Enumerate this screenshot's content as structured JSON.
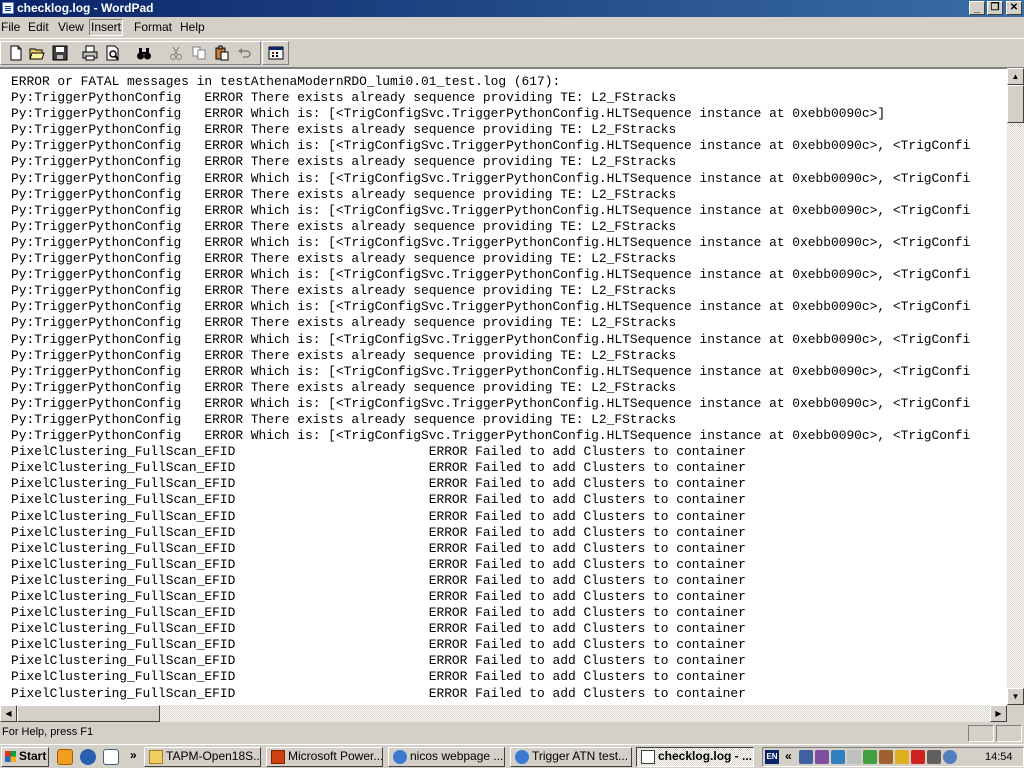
{
  "window": {
    "title": "checklog.log - WordPad",
    "buttons": {
      "minimize": "_",
      "maximize": "❐",
      "close": "✕"
    }
  },
  "menu": [
    "File",
    "Edit",
    "View",
    "Insert",
    "Format",
    "Help"
  ],
  "toolbar": {
    "icons": [
      "new-document-icon",
      "open-folder-icon",
      "save-disk-icon",
      "print-icon",
      "print-preview-icon",
      "find-binoculars-icon",
      "cut-scissors-icon",
      "copy-icon",
      "paste-icon",
      "undo-icon",
      "insert-date-time-icon"
    ]
  },
  "document": {
    "lines": [
      "ERROR or FATAL messages in testAthenaModernRDO_lumi0.01_test.log (617):",
      "Py:TriggerPythonConfig   ERROR There exists already sequence providing TE: L2_FStracks",
      "Py:TriggerPythonConfig   ERROR Which is: [<TrigConfigSvc.TriggerPythonConfig.HLTSequence instance at 0xebb0090c>]",
      "Py:TriggerPythonConfig   ERROR There exists already sequence providing TE: L2_FStracks",
      "Py:TriggerPythonConfig   ERROR Which is: [<TrigConfigSvc.TriggerPythonConfig.HLTSequence instance at 0xebb0090c>, <TrigConfi",
      "Py:TriggerPythonConfig   ERROR There exists already sequence providing TE: L2_FStracks",
      "Py:TriggerPythonConfig   ERROR Which is: [<TrigConfigSvc.TriggerPythonConfig.HLTSequence instance at 0xebb0090c>, <TrigConfi",
      "Py:TriggerPythonConfig   ERROR There exists already sequence providing TE: L2_FStracks",
      "Py:TriggerPythonConfig   ERROR Which is: [<TrigConfigSvc.TriggerPythonConfig.HLTSequence instance at 0xebb0090c>, <TrigConfi",
      "Py:TriggerPythonConfig   ERROR There exists already sequence providing TE: L2_FStracks",
      "Py:TriggerPythonConfig   ERROR Which is: [<TrigConfigSvc.TriggerPythonConfig.HLTSequence instance at 0xebb0090c>, <TrigConfi",
      "Py:TriggerPythonConfig   ERROR There exists already sequence providing TE: L2_FStracks",
      "Py:TriggerPythonConfig   ERROR Which is: [<TrigConfigSvc.TriggerPythonConfig.HLTSequence instance at 0xebb0090c>, <TrigConfi",
      "Py:TriggerPythonConfig   ERROR There exists already sequence providing TE: L2_FStracks",
      "Py:TriggerPythonConfig   ERROR Which is: [<TrigConfigSvc.TriggerPythonConfig.HLTSequence instance at 0xebb0090c>, <TrigConfi",
      "Py:TriggerPythonConfig   ERROR There exists already sequence providing TE: L2_FStracks",
      "Py:TriggerPythonConfig   ERROR Which is: [<TrigConfigSvc.TriggerPythonConfig.HLTSequence instance at 0xebb0090c>, <TrigConfi",
      "Py:TriggerPythonConfig   ERROR There exists already sequence providing TE: L2_FStracks",
      "Py:TriggerPythonConfig   ERROR Which is: [<TrigConfigSvc.TriggerPythonConfig.HLTSequence instance at 0xebb0090c>, <TrigConfi",
      "Py:TriggerPythonConfig   ERROR There exists already sequence providing TE: L2_FStracks",
      "Py:TriggerPythonConfig   ERROR Which is: [<TrigConfigSvc.TriggerPythonConfig.HLTSequence instance at 0xebb0090c>, <TrigConfi",
      "Py:TriggerPythonConfig   ERROR There exists already sequence providing TE: L2_FStracks",
      "Py:TriggerPythonConfig   ERROR Which is: [<TrigConfigSvc.TriggerPythonConfig.HLTSequence instance at 0xebb0090c>, <TrigConfi",
      "PixelClustering_FullScan_EFID                         ERROR Failed to add Clusters to container",
      "PixelClustering_FullScan_EFID                         ERROR Failed to add Clusters to container",
      "PixelClustering_FullScan_EFID                         ERROR Failed to add Clusters to container",
      "PixelClustering_FullScan_EFID                         ERROR Failed to add Clusters to container",
      "PixelClustering_FullScan_EFID                         ERROR Failed to add Clusters to container",
      "PixelClustering_FullScan_EFID                         ERROR Failed to add Clusters to container",
      "PixelClustering_FullScan_EFID                         ERROR Failed to add Clusters to container",
      "PixelClustering_FullScan_EFID                         ERROR Failed to add Clusters to container",
      "PixelClustering_FullScan_EFID                         ERROR Failed to add Clusters to container",
      "PixelClustering_FullScan_EFID                         ERROR Failed to add Clusters to container",
      "PixelClustering_FullScan_EFID                         ERROR Failed to add Clusters to container",
      "PixelClustering_FullScan_EFID                         ERROR Failed to add Clusters to container",
      "PixelClustering_FullScan_EFID                         ERROR Failed to add Clusters to container",
      "PixelClustering_FullScan_EFID                         ERROR Failed to add Clusters to container",
      "PixelClustering_FullScan_EFID                         ERROR Failed to add Clusters to container",
      "PixelClustering_FullScan_EFID                         ERROR Failed to add Clusters to container"
    ]
  },
  "statusbar": {
    "text": "For Help, press F1"
  },
  "taskbar": {
    "start_label": "Start",
    "overflow": "»",
    "tasks": [
      {
        "label": "TAPM-Open18S...",
        "icon": "folder-icon",
        "active": false
      },
      {
        "label": "Microsoft Power...",
        "icon": "powerpoint-icon",
        "active": false
      },
      {
        "label": "nicos webpage ...",
        "icon": "ie-browser-icon",
        "active": false
      },
      {
        "label": "Trigger ATN test...",
        "icon": "ie-browser-icon",
        "active": false
      },
      {
        "label": "checklog.log - ...",
        "icon": "wordpad-icon",
        "active": true
      }
    ],
    "tray": {
      "language": "EN",
      "chevron": "«",
      "clock": "14:54"
    }
  },
  "colors": {
    "titlebar_start": "#0a246a",
    "titlebar_end": "#3a6ea5",
    "chrome": "#d4d0c8"
  }
}
